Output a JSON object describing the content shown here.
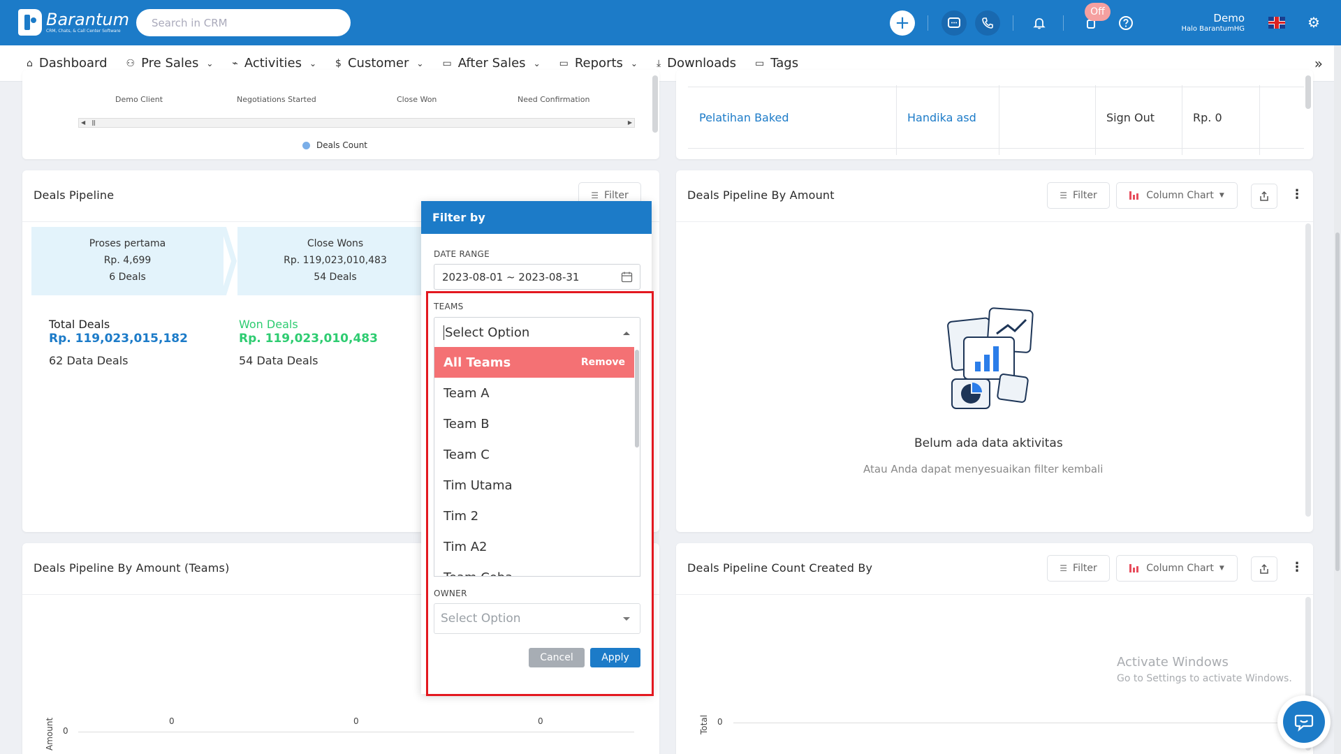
{
  "app": {
    "name": "Barantum",
    "tagline": "CRM, Chats, & Call Center Software",
    "search_placeholder": "Search in CRM",
    "off_badge": "Off",
    "user_name": "Demo",
    "user_sub": "Halo BarantumHG"
  },
  "nav": {
    "items": [
      {
        "label": "Dashboard",
        "icon": "home-icon",
        "dropdown": false
      },
      {
        "label": "Pre Sales",
        "icon": "users-icon",
        "dropdown": true
      },
      {
        "label": "Activities",
        "icon": "activity-icon",
        "dropdown": true
      },
      {
        "label": "Customer",
        "icon": "dollar-icon",
        "dropdown": true
      },
      {
        "label": "After Sales",
        "icon": "folder-icon",
        "dropdown": true
      },
      {
        "label": "Reports",
        "icon": "folder-icon",
        "dropdown": true
      },
      {
        "label": "Downloads",
        "icon": "download-icon",
        "dropdown": false
      },
      {
        "label": "Tags",
        "icon": "folder-icon",
        "dropdown": false
      }
    ]
  },
  "top_left_chart": {
    "categories": [
      "Demo Client",
      "Negotiations Started",
      "Close Won",
      "Need Confirmation"
    ],
    "legend": "Deals Count"
  },
  "top_right_table": {
    "row": [
      "Pelatihan Baked",
      "Handika asd",
      "",
      "Sign Out",
      "Rp. 0"
    ]
  },
  "deals_pipeline": {
    "title": "Deals Pipeline",
    "filter_label": "Filter",
    "stages": [
      {
        "name": "Proses pertama",
        "amount": "Rp. 4,699",
        "deals": "6 Deals"
      },
      {
        "name": "Close Wons",
        "amount": "Rp. 119,023,010,483",
        "deals": "54 Deals"
      }
    ],
    "total": {
      "label": "Total Deals",
      "amount": "Rp. 119,023,015,182",
      "count": "62 Data Deals"
    },
    "won": {
      "label": "Won Deals",
      "amount": "Rp. 119,023,010,483",
      "count": "54 Data Deals"
    }
  },
  "pipeline_by_amount": {
    "title": "Deals Pipeline By Amount",
    "filter_label": "Filter",
    "chart_type_label": "Column Chart",
    "empty_title": "Belum ada data aktivitas",
    "empty_sub": "Atau Anda dapat menyesuaikan filter kembali"
  },
  "pipeline_by_amount_teams": {
    "title": "Deals Pipeline By Amount (Teams)",
    "ylabel": "Amount",
    "y_zero": "0",
    "bar_labels": [
      "0",
      "0",
      "0"
    ]
  },
  "pipeline_count_created_by": {
    "title": "Deals Pipeline Count Created By",
    "filter_label": "Filter",
    "chart_type_label": "Column Chart",
    "ylabel": "Total",
    "y_zero": "0"
  },
  "filter_popover": {
    "title": "Filter by",
    "date_range_label": "DATE RANGE",
    "date_range_value": "2023-08-01 ~ 2023-08-31",
    "teams_label": "TEAMS",
    "teams_search_placeholder": "Select Option",
    "selected_team": "All Teams",
    "remove_label": "Remove",
    "team_options": [
      "Team A",
      "Team B",
      "Team C",
      "Tim Utama",
      "Tim 2",
      "Tim A2",
      "Team Coba"
    ],
    "owner_label": "OWNER",
    "owner_placeholder": "Select Option",
    "cancel_label": "Cancel",
    "apply_label": "Apply"
  },
  "watermark": {
    "line1": "Activate Windows",
    "line2": "Go to Settings to activate Windows."
  },
  "colors": {
    "brand": "#1c7bc8",
    "won_green": "#2ecc71",
    "selected_option": "#f47174",
    "highlight_border": "#e3181f",
    "stage_bg": "#e3f3fb"
  }
}
